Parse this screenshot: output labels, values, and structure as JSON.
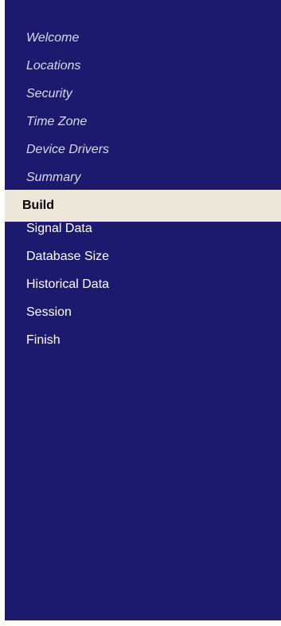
{
  "wizard": {
    "steps": [
      {
        "label": "Welcome",
        "state": "completed"
      },
      {
        "label": "Locations",
        "state": "completed"
      },
      {
        "label": "Security",
        "state": "completed"
      },
      {
        "label": "Time Zone",
        "state": "completed"
      },
      {
        "label": "Device Drivers",
        "state": "completed"
      },
      {
        "label": "Summary",
        "state": "completed"
      },
      {
        "label": "Build",
        "state": "current"
      },
      {
        "label": "Signal Data",
        "state": "upcoming"
      },
      {
        "label": "Database Size",
        "state": "upcoming"
      },
      {
        "label": "Historical Data",
        "state": "upcoming"
      },
      {
        "label": "Session",
        "state": "upcoming"
      },
      {
        "label": "Finish",
        "state": "upcoming"
      }
    ]
  },
  "colors": {
    "sidebar_background": "#1c1a6e",
    "current_step_background": "#ece7d8",
    "completed_text": "#d9d9e6",
    "upcoming_text": "#ffffff",
    "current_text": "#000000"
  }
}
